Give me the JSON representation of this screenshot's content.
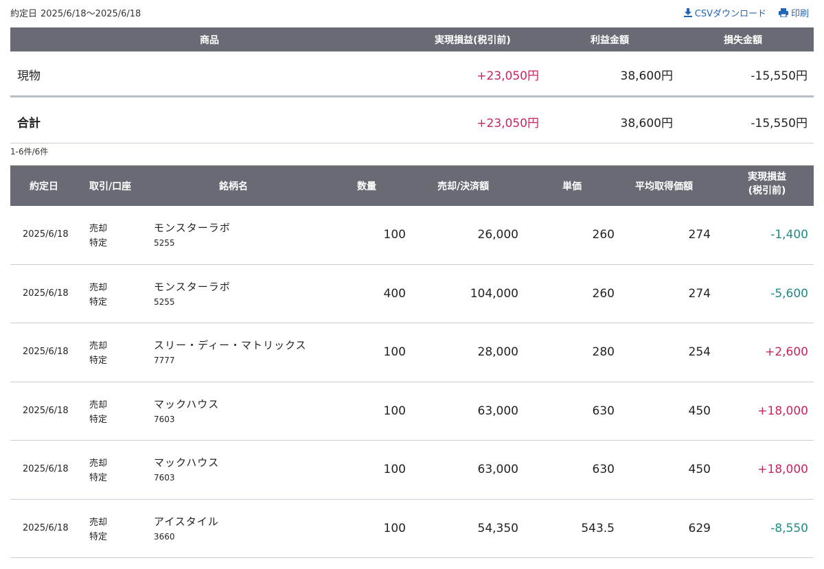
{
  "header": {
    "period_label": "約定日",
    "period_value": "2025/6/18〜2025/6/18",
    "csv_label": "CSVダウンロード",
    "print_label": "印刷",
    "csv_icon": "download-icon",
    "print_icon": "printer-icon"
  },
  "colors": {
    "header_bg": "#686b74",
    "positive": "#c8245d",
    "negative": "#1e8b86",
    "link": "#1f65b8"
  },
  "summary": {
    "columns": [
      "商品",
      "実現損益(税引前)",
      "利益金額",
      "損失金額"
    ],
    "rows": [
      {
        "name": "現物",
        "pl": "+23,050円",
        "profit": "38,600円",
        "loss": "-15,550円"
      }
    ],
    "total": {
      "name": "合計",
      "pl": "+23,050円",
      "profit": "38,600円",
      "loss": "-15,550円"
    }
  },
  "count_text": "1-6件/6件",
  "detail": {
    "columns": {
      "date": "約定日",
      "type": "取引/口座",
      "name": "銘柄名",
      "qty": "数量",
      "amount": "売却/決済額",
      "price": "単価",
      "avg": "平均取得価額",
      "pl_line1": "実現損益",
      "pl_line2": "(税引前)"
    },
    "rows": [
      {
        "date": "2025/6/18",
        "trade": "売却",
        "account": "特定",
        "name": "モンスターラボ",
        "code": "5255",
        "qty": "100",
        "amount": "26,000",
        "price": "260",
        "avg": "274",
        "pl": "-1,400"
      },
      {
        "date": "2025/6/18",
        "trade": "売却",
        "account": "特定",
        "name": "モンスターラボ",
        "code": "5255",
        "qty": "400",
        "amount": "104,000",
        "price": "260",
        "avg": "274",
        "pl": "-5,600"
      },
      {
        "date": "2025/6/18",
        "trade": "売却",
        "account": "特定",
        "name": "スリー・ディー・マトリックス",
        "code": "7777",
        "qty": "100",
        "amount": "28,000",
        "price": "280",
        "avg": "254",
        "pl": "+2,600"
      },
      {
        "date": "2025/6/18",
        "trade": "売却",
        "account": "特定",
        "name": "マックハウス",
        "code": "7603",
        "qty": "100",
        "amount": "63,000",
        "price": "630",
        "avg": "450",
        "pl": "+18,000"
      },
      {
        "date": "2025/6/18",
        "trade": "売却",
        "account": "特定",
        "name": "マックハウス",
        "code": "7603",
        "qty": "100",
        "amount": "63,000",
        "price": "630",
        "avg": "450",
        "pl": "+18,000"
      },
      {
        "date": "2025/6/18",
        "trade": "売却",
        "account": "特定",
        "name": "アイスタイル",
        "code": "3660",
        "qty": "100",
        "amount": "54,350",
        "price": "543.5",
        "avg": "629",
        "pl": "-8,550"
      }
    ]
  }
}
